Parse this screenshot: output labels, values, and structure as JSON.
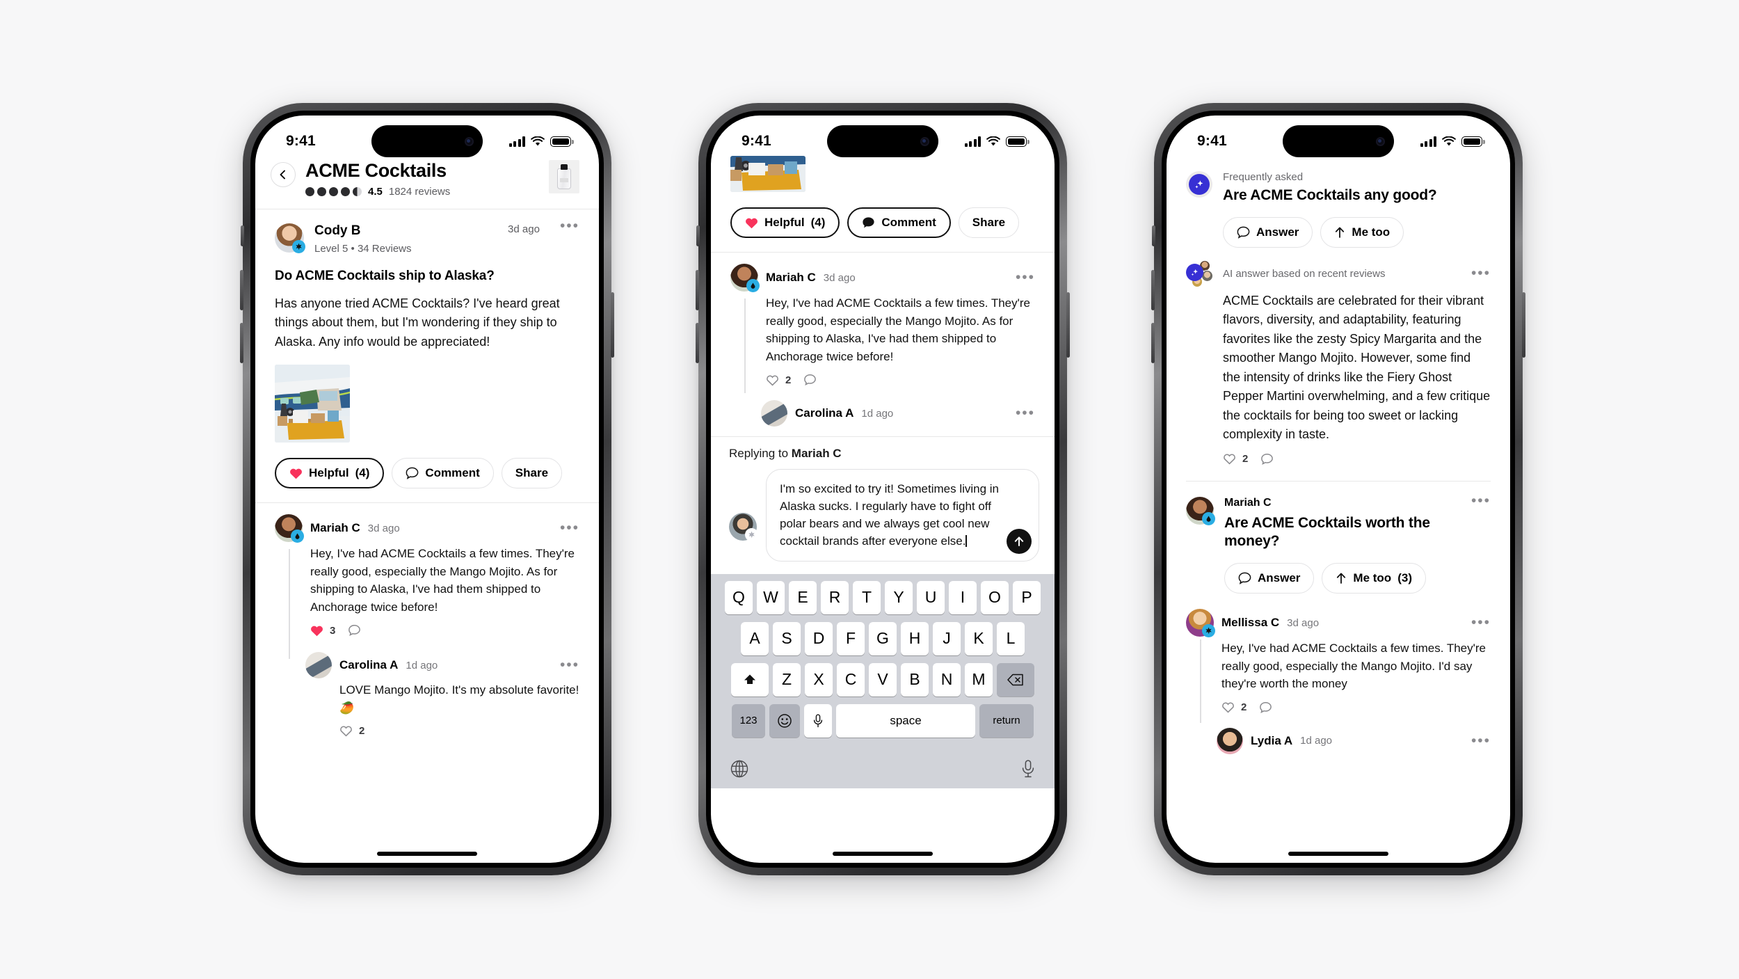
{
  "statusbar": {
    "time": "9:41"
  },
  "phone1": {
    "header": {
      "title": "ACME Cocktails",
      "rating_value": "4.5",
      "rating_count": "1824 reviews",
      "rating_filled": 4,
      "rating_half": true
    },
    "post": {
      "author": "Cody B",
      "meta": "Level 5  •  34 Reviews",
      "time": "3d ago",
      "question": "Do ACME Cocktails ship to Alaska?",
      "body": "Has anyone tried ACME Cocktails? I've heard great things about them, but I'm wondering if they ship to Alaska. Any info would be appreciated!"
    },
    "actions": {
      "helpful": "Helpful",
      "helpful_count": "(4)",
      "comment": "Comment",
      "share": "Share"
    },
    "comments": [
      {
        "author": "Mariah C",
        "time": "3d ago",
        "body": "Hey, I've had ACME Cocktails a few times. They're really good, especially the Mango Mojito. As for shipping to Alaska, I've had them shipped to Anchorage twice before!",
        "likes": "3",
        "liked": true
      },
      {
        "author": "Carolina A",
        "time": "1d ago",
        "body": "LOVE Mango Mojito. It's my absolute favorite! 🥭",
        "likes": "2",
        "liked": false
      }
    ]
  },
  "phone2": {
    "actions": {
      "helpful": "Helpful",
      "helpful_count": "(4)",
      "comment": "Comment",
      "share": "Share"
    },
    "comments": [
      {
        "author": "Mariah C",
        "time": "3d ago",
        "body": "Hey, I've had ACME Cocktails a few times. They're really good, especially the Mango Mojito. As for shipping to Alaska, I've had them shipped to Anchorage twice before!",
        "likes": "2"
      },
      {
        "author": "Carolina A",
        "time": "1d ago"
      }
    ],
    "compose": {
      "replying_prefix": "Replying to ",
      "replying_to": "Mariah C",
      "value": "I'm so excited to try it! Sometimes living in Alaska sucks. I regularly have to fight off polar bears and we always get cool new cocktail brands after everyone else.",
      "send_icon": "arrow-up-icon"
    },
    "keyboard": {
      "row1": [
        "Q",
        "W",
        "E",
        "R",
        "T",
        "Y",
        "U",
        "I",
        "O",
        "P"
      ],
      "row2": [
        "A",
        "S",
        "D",
        "F",
        "G",
        "H",
        "J",
        "K",
        "L"
      ],
      "row3": [
        "Z",
        "X",
        "C",
        "V",
        "B",
        "N",
        "M"
      ],
      "shift": "shift-icon",
      "backspace": "backspace-icon",
      "numbers": "123",
      "emoji": "emoji-icon",
      "dictate": "microphone-icon",
      "space": "space",
      "return": "return",
      "globe": "globe-icon",
      "mic": "microphone-icon"
    }
  },
  "phone3": {
    "faq": {
      "label": "Frequently asked",
      "question": "Are ACME Cocktails any good?",
      "answer_btn": "Answer",
      "metoo_btn": "Me too"
    },
    "ai_answer": {
      "label": "AI answer based on recent reviews",
      "text": "ACME Cocktails are celebrated for their vibrant flavors, diversity, and adaptability, featuring favorites like the zesty Spicy Margarita and the smoother Mango Mojito. However, some find the intensity of drinks like the Fiery Ghost Pepper Martini overwhelming, and a few critique the cocktails for being too sweet or lacking complexity in taste.",
      "likes": "2"
    },
    "question2": {
      "author": "Mariah C",
      "question": "Are ACME Cocktails worth the money?",
      "answer_btn": "Answer",
      "metoo_btn": "Me too",
      "metoo_count": "(3)"
    },
    "comments": [
      {
        "author": "Mellissa C",
        "time": "3d ago",
        "body": "Hey, I've had ACME Cocktails a few times. They're really good, especially the Mango Mojito. I'd say they're worth the money",
        "likes": "2"
      },
      {
        "author": "Lydia A",
        "time": "1d ago"
      }
    ]
  },
  "colors": {
    "heart_active": "#f8335c",
    "ai_accent": "#3730d4",
    "badge_blue": "#2aade3",
    "background": "#f7f7f8"
  }
}
